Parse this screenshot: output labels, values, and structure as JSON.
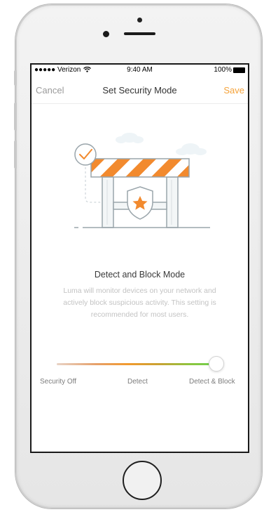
{
  "status_bar": {
    "carrier": "●●●●● Verizon",
    "wifi_icon": "wifi-icon",
    "time": "9:40 AM",
    "battery": "100%"
  },
  "nav": {
    "cancel_label": "Cancel",
    "title": "Set Security Mode",
    "save_label": "Save"
  },
  "mode": {
    "title": "Detect and Block Mode",
    "description": "Luma will monitor devices on your network and actively block suspicious activity. This setting is recommended for most users."
  },
  "slider": {
    "options": [
      "Security Off",
      "Detect",
      "Detect & Block"
    ],
    "selected": "Detect & Block",
    "selected_index": 2
  },
  "colors": {
    "accent": "#f5a33b",
    "barricade_orange": "#f28a2e",
    "slider_green": "#6fcf4f"
  }
}
